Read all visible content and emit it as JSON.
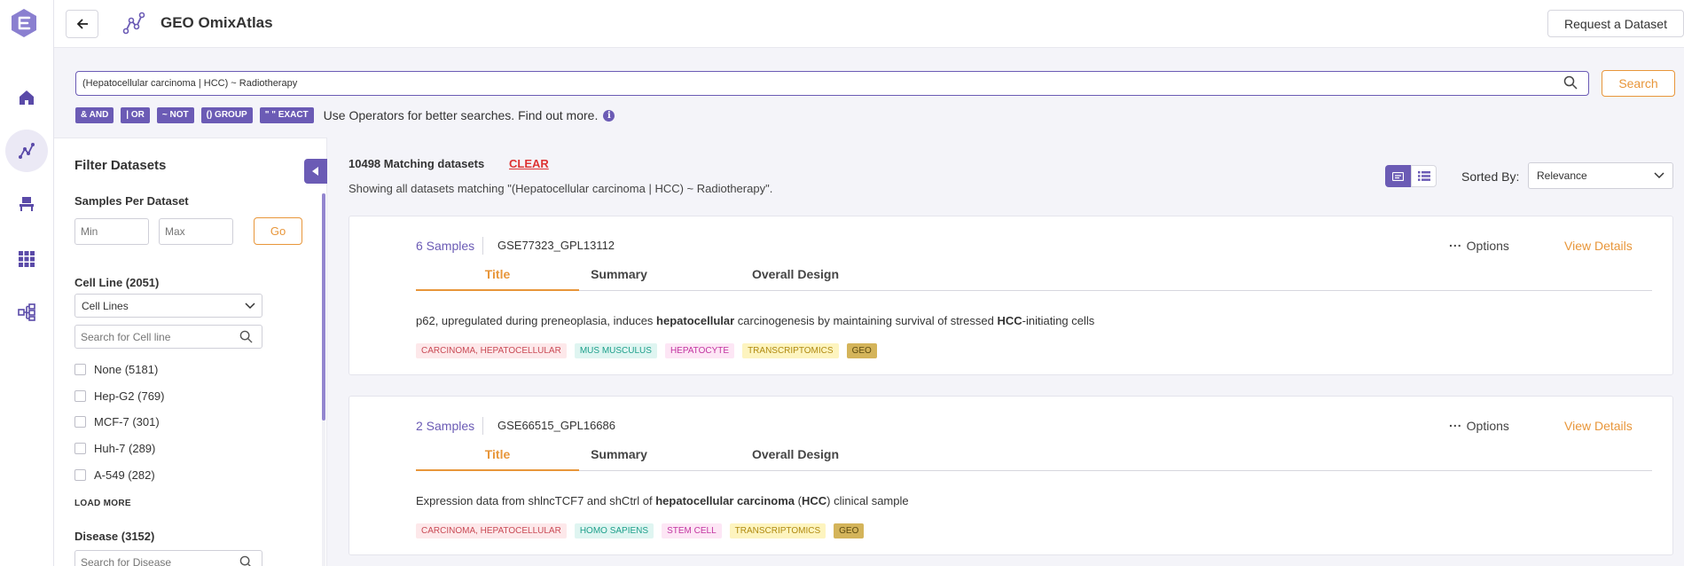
{
  "header": {
    "title": "GEO OmixAtlas",
    "request_button": "Request a Dataset"
  },
  "search": {
    "query": "(Hepatocellular carcinoma | HCC) ~ Radiotherapy",
    "button": "Search",
    "operators": [
      "& AND",
      "| OR",
      "~ NOT",
      "() GROUP",
      "\" \" EXACT"
    ],
    "hint": "Use Operators for better searches. Find out more."
  },
  "filter": {
    "title": "Filter Datasets",
    "samples_label": "Samples Per Dataset",
    "min_placeholder": "Min",
    "max_placeholder": "Max",
    "go_button": "Go",
    "cell_line": {
      "label": "Cell Line (2051)",
      "select_value": "Cell Lines",
      "search_placeholder": "Search for Cell line",
      "options": [
        "None (5181)",
        "Hep-G2 (769)",
        "MCF-7 (301)",
        "Huh-7 (289)",
        "A-549 (282)"
      ]
    },
    "load_more": "LOAD MORE",
    "disease": {
      "label": "Disease (3152)",
      "search_placeholder": "Search for Disease"
    }
  },
  "results": {
    "count": "10498 Matching datasets",
    "clear": "CLEAR",
    "subtitle": "Showing all datasets matching \"(Hepatocellular carcinoma | HCC) ~ Radiotherapy\".",
    "sorted_label": "Sorted By:",
    "sort_value": "Relevance",
    "options_label": "Options",
    "view_details_label": "View Details",
    "tabs": [
      "Title",
      "Summary",
      "Overall Design"
    ]
  },
  "datasets": [
    {
      "samples": "6 Samples",
      "accession": "GSE77323_GPL13112",
      "title_parts": [
        {
          "text": "p62, upregulated during preneoplasia, induces ",
          "bold": false
        },
        {
          "text": "hepatocellular",
          "bold": true
        },
        {
          "text": " carcinogenesis by maintaining survival of stressed ",
          "bold": false
        },
        {
          "text": "HCC",
          "bold": true
        },
        {
          "text": "-initiating cells",
          "bold": false
        }
      ],
      "tags": [
        {
          "label": "CARCINOMA, HEPATOCELLULAR",
          "kind": "disease"
        },
        {
          "label": "MUS MUSCULUS",
          "kind": "organism"
        },
        {
          "label": "HEPATOCYTE",
          "kind": "celltype"
        },
        {
          "label": "TRANSCRIPTOMICS",
          "kind": "assay"
        },
        {
          "label": "GEO",
          "kind": "source"
        }
      ]
    },
    {
      "samples": "2 Samples",
      "accession": "GSE66515_GPL16686",
      "title_parts": [
        {
          "text": "Expression data from shlncTCF7 and shCtrl of ",
          "bold": false
        },
        {
          "text": "hepatocellular carcinoma",
          "bold": true
        },
        {
          "text": " (",
          "bold": false
        },
        {
          "text": "HCC",
          "bold": true
        },
        {
          "text": ") clinical sample",
          "bold": false
        }
      ],
      "tags": [
        {
          "label": "CARCINOMA, HEPATOCELLULAR",
          "kind": "disease"
        },
        {
          "label": "HOMO SAPIENS",
          "kind": "organism"
        },
        {
          "label": "STEM CELL",
          "kind": "celltype"
        },
        {
          "label": "TRANSCRIPTOMICS",
          "kind": "assay"
        },
        {
          "label": "GEO",
          "kind": "source"
        }
      ]
    }
  ],
  "colors": {
    "accent": "#6b5bb5",
    "orange": "#e8963a",
    "clear_red": "#d33333"
  },
  "icons": [
    "app-logo-icon",
    "home-icon",
    "omixatlas-icon",
    "workspace-icon",
    "apps-grid-icon",
    "pipeline-icon",
    "back-arrow-icon",
    "search-icon",
    "info-icon",
    "chevron-left-icon",
    "chevron-down-icon",
    "card-view-icon",
    "list-view-icon"
  ]
}
